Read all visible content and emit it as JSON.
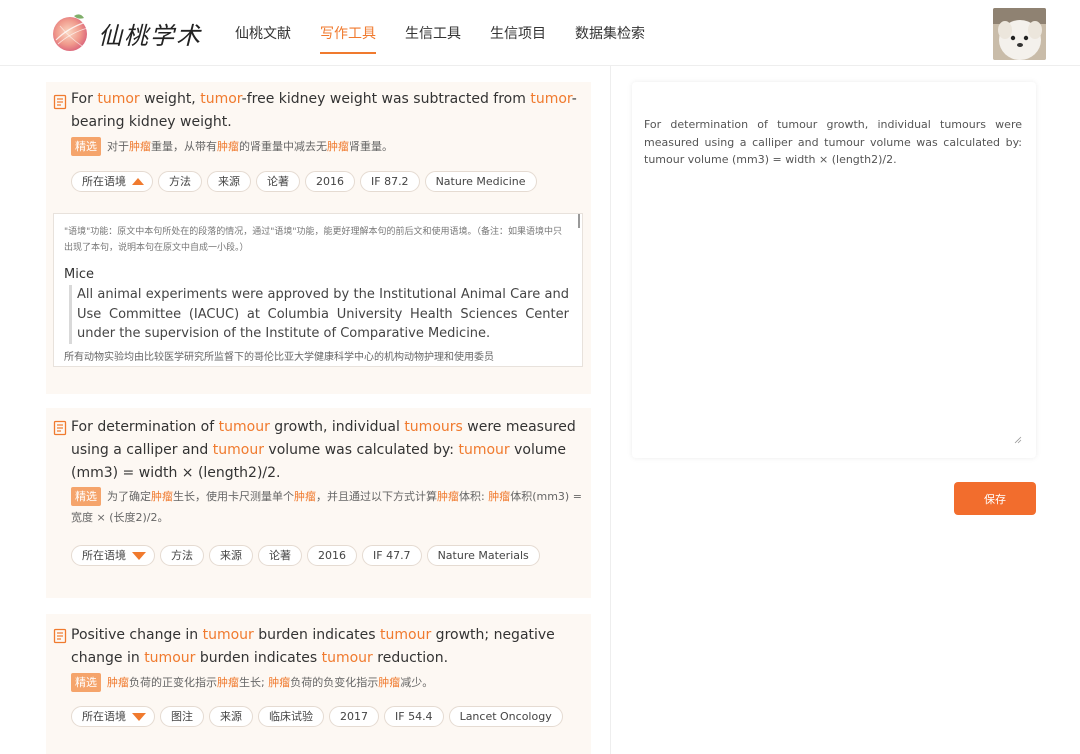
{
  "brand": {
    "name": "仙桃学术"
  },
  "nav": {
    "items": [
      "仙桃文献",
      "写作工具",
      "生信工具",
      "生信项目",
      "数据集检索"
    ],
    "active_index": 1
  },
  "colors": {
    "accent": "#f07a2e",
    "card_bg": "#fdf8f3",
    "badge": "#f5a46b",
    "save_button": "#f26d2d"
  },
  "cards": [
    {
      "sentence": [
        {
          "t": "For ",
          "h": false
        },
        {
          "t": "tumor",
          "h": true
        },
        {
          "t": " weight, ",
          "h": false
        },
        {
          "t": "tumor",
          "h": true
        },
        {
          "t": "-free kidney weight was subtracted from ",
          "h": false
        },
        {
          "t": "tumor",
          "h": true
        },
        {
          "t": "-bearing kidney weight.",
          "h": false
        }
      ],
      "badge": "精选",
      "translation": [
        {
          "t": "对于",
          "h": false
        },
        {
          "t": "肿瘤",
          "h": true
        },
        {
          "t": "重量，从带有",
          "h": false
        },
        {
          "t": "肿瘤",
          "h": true
        },
        {
          "t": "的肾重量中减去无",
          "h": false
        },
        {
          "t": "肿瘤",
          "h": true
        },
        {
          "t": "肾重量。",
          "h": false
        }
      ],
      "context_label": "所在语境",
      "context_expanded": true,
      "tags": [
        "方法",
        "来源",
        "论著",
        "2016",
        "IF 87.2",
        "Nature Medicine"
      ],
      "context": {
        "note": "\"语境\"功能：原文中本句所处在的段落的情况，通过\"语境\"功能，能更好理解本句的前后文和使用语境。（备注：如果语境中只出现了本句，说明本句在原文中自成一小段。）",
        "title": "Mice",
        "quote": "All animal experiments were approved by the Institutional Animal Care and Use Committee (IACUC) at Columbia University Health Sciences Center under the supervision of the Institute of Comparative Medicine.",
        "translation": "所有动物实验均由比较医学研究所监督下的哥伦比亚大学健康科学中心的机构动物护理和使用委员"
      }
    },
    {
      "sentence": [
        {
          "t": "For determination of ",
          "h": false
        },
        {
          "t": "tumour",
          "h": true
        },
        {
          "t": " growth, individual ",
          "h": false
        },
        {
          "t": "tumours",
          "h": true
        },
        {
          "t": " were measured using a calliper and ",
          "h": false
        },
        {
          "t": "tumour",
          "h": true
        },
        {
          "t": " volume was calculated by: ",
          "h": false
        },
        {
          "t": "tumour",
          "h": true
        },
        {
          "t": " volume (mm3) = width × (length2)/2.",
          "h": false
        }
      ],
      "badge": "精选",
      "translation": [
        {
          "t": "为了确定",
          "h": false
        },
        {
          "t": "肿瘤",
          "h": true
        },
        {
          "t": "生长，使用卡尺测量单个",
          "h": false
        },
        {
          "t": "肿瘤",
          "h": true
        },
        {
          "t": "，并且通过以下方式计算",
          "h": false
        },
        {
          "t": "肿瘤",
          "h": true
        },
        {
          "t": "体积: ",
          "h": false
        },
        {
          "t": "肿瘤",
          "h": true
        },
        {
          "t": "体积(mm3) = 宽度 × (长度2)/2。",
          "h": false
        }
      ],
      "context_label": "所在语境",
      "context_expanded": false,
      "tags": [
        "方法",
        "来源",
        "论著",
        "2016",
        "IF 47.7",
        "Nature Materials"
      ]
    },
    {
      "sentence": [
        {
          "t": "Positive change in ",
          "h": false
        },
        {
          "t": "tumour",
          "h": true
        },
        {
          "t": " burden indicates ",
          "h": false
        },
        {
          "t": "tumour",
          "h": true
        },
        {
          "t": " growth; negative change in ",
          "h": false
        },
        {
          "t": "tumour",
          "h": true
        },
        {
          "t": " burden indicates ",
          "h": false
        },
        {
          "t": "tumour",
          "h": true
        },
        {
          "t": " reduction.",
          "h": false
        }
      ],
      "badge": "精选",
      "translation": [
        {
          "t": "肿瘤",
          "h": true
        },
        {
          "t": "负荷的正变化指示",
          "h": false
        },
        {
          "t": "肿瘤",
          "h": true
        },
        {
          "t": "生长; ",
          "h": false
        },
        {
          "t": "肿瘤",
          "h": true
        },
        {
          "t": "负荷的负变化指示",
          "h": false
        },
        {
          "t": "肿瘤",
          "h": true
        },
        {
          "t": "减少。",
          "h": false
        }
      ],
      "context_label": "所在语境",
      "context_expanded": false,
      "tags": [
        "图注",
        "来源",
        "临床试验",
        "2017",
        "IF 54.4",
        "Lancet Oncology"
      ]
    }
  ],
  "editor": {
    "text": "For determination of tumour growth, individual tumours were measured using a calliper and tumour volume was calculated by: tumour volume (mm3) = width × (length2)/2."
  },
  "save_button": {
    "label": "保存"
  }
}
